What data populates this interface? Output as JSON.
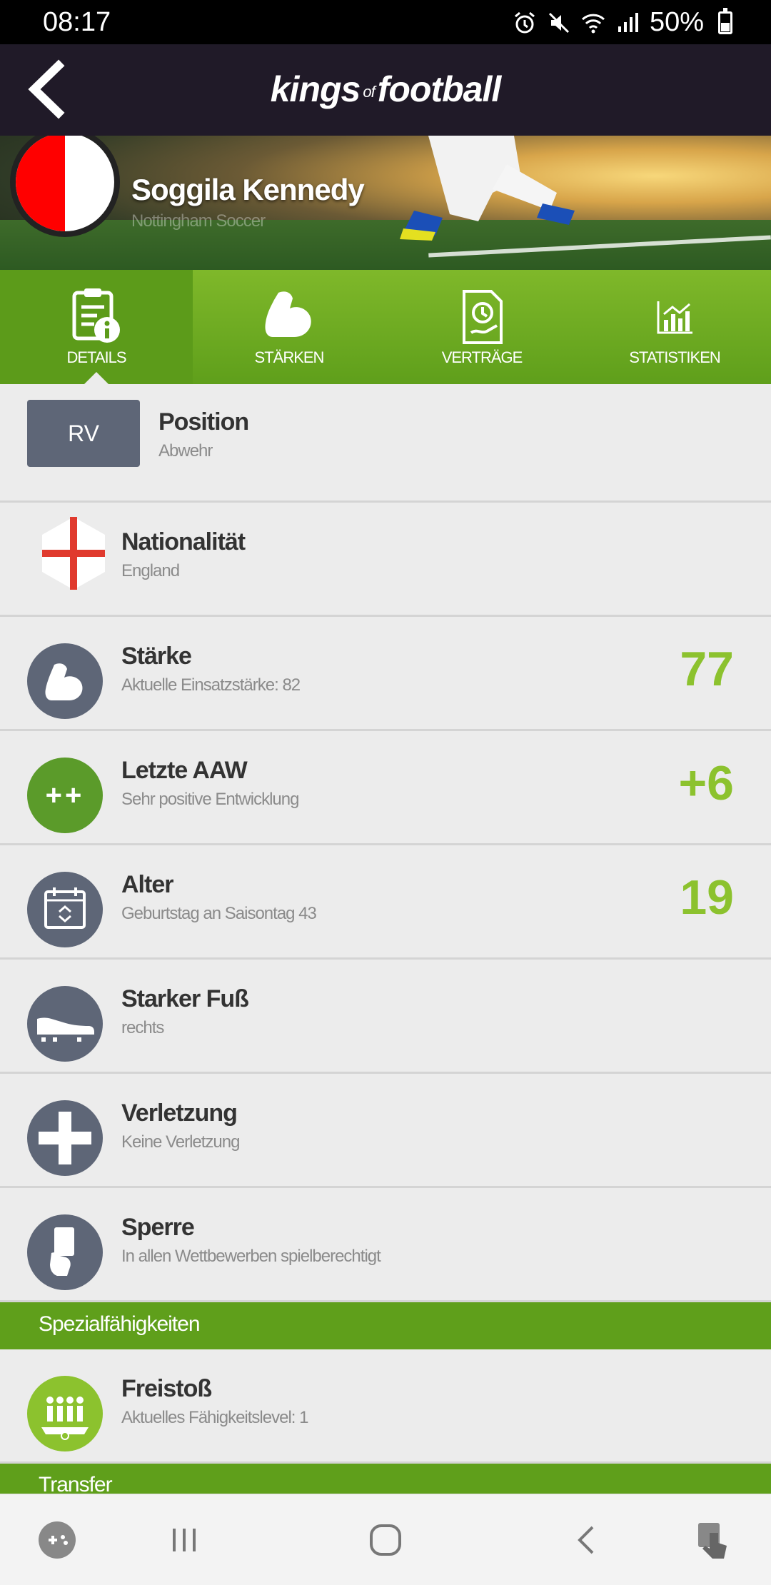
{
  "status_bar": {
    "time": "08:17",
    "battery": "50%"
  },
  "header": {
    "logo_part1": "kings",
    "logo_of": "of",
    "logo_part2": "football"
  },
  "player": {
    "name": "Soggila Kennedy",
    "club": "Nottingham Soccer"
  },
  "tabs": [
    {
      "label": "DETAILS",
      "icon": "details-icon",
      "active": true
    },
    {
      "label": "STÄRKEN",
      "icon": "strength-icon"
    },
    {
      "label": "VERTRÄGE",
      "icon": "contract-icon"
    },
    {
      "label": "STATISTIKEN",
      "icon": "statistics-icon"
    }
  ],
  "details": {
    "position": {
      "badge": "RV",
      "title": "Position",
      "sub": "Abwehr"
    },
    "nationality": {
      "title": "Nationalität",
      "sub": "England"
    },
    "strength": {
      "title": "Stärke",
      "sub": "Aktuelle Einsatzstärke: 82",
      "value": "77"
    },
    "last_aaw": {
      "title": "Letzte AAW",
      "sub": "Sehr positive Entwicklung",
      "value": "+6",
      "icon_text": "++"
    },
    "age": {
      "title": "Alter",
      "sub": "Geburtstag an Saisontag 43",
      "value": "19"
    },
    "foot": {
      "title": "Starker Fuß",
      "sub": "rechts"
    },
    "injury": {
      "title": "Verletzung",
      "sub": "Keine Verletzung"
    },
    "suspension": {
      "title": "Sperre",
      "sub": "In allen Wettbewerben spielberechtigt"
    }
  },
  "special_skills": {
    "header": "Spezialfähigkeiten",
    "items": [
      {
        "title": "Freistoß",
        "sub": "Aktuelles Fähigkeitslevel: 1"
      }
    ]
  },
  "transfer": {
    "header": "Transfer"
  },
  "colors": {
    "accent_green": "#8cc22e",
    "tab_green": "#5f9f1b",
    "icon_grey": "#5e6677",
    "header_dark": "#201a28"
  }
}
